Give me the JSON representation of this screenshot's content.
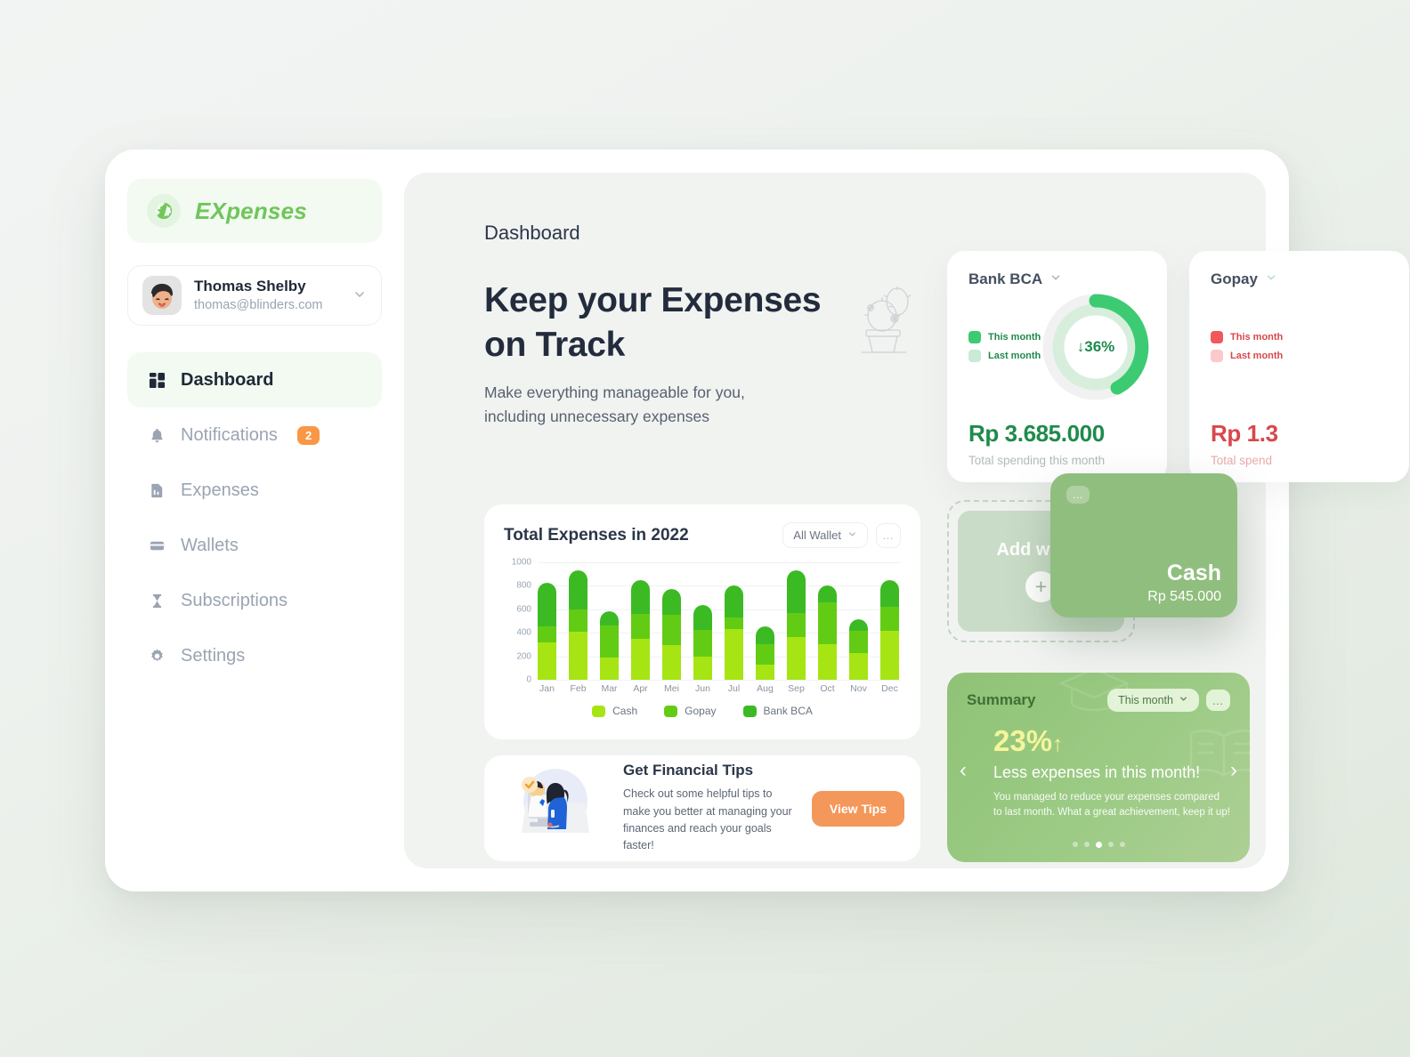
{
  "sidebar": {
    "brand": {
      "name": "EXpenses",
      "icon": "globe-icon"
    },
    "profile": {
      "name": "Thomas Shelby",
      "email": "thomas@blinders.com",
      "chevron": "chevron-down-icon"
    },
    "items": [
      {
        "label": "Dashboard",
        "icon": "grid-icon",
        "active": true,
        "badge": ""
      },
      {
        "label": "Notifications",
        "icon": "bell-icon",
        "active": false,
        "badge": "2"
      },
      {
        "label": "Expenses",
        "icon": "document-icon",
        "active": false,
        "badge": ""
      },
      {
        "label": "Wallets",
        "icon": "card-icon",
        "active": false,
        "badge": ""
      },
      {
        "label": "Subscriptions",
        "icon": "hourglass-icon",
        "active": false,
        "badge": ""
      },
      {
        "label": "Settings",
        "icon": "gear-icon",
        "active": false,
        "badge": ""
      }
    ]
  },
  "main": {
    "breadcrumb": "Dashboard",
    "hero_line1": "Keep your Expenses",
    "hero_line2": "on Track",
    "hero_sub1": "Make everything manageable for you,",
    "hero_sub2": "including unnecessary expenses",
    "hero_illustration": "cactus-icon"
  },
  "chart_card": {
    "title": "Total Expenses in 2022",
    "wallet_filter": "All Wallet",
    "filter_chevron": "chevron-down-icon",
    "more": "…"
  },
  "chart_data": {
    "type": "bar",
    "title": "Total Expenses in 2022",
    "xlabel": "",
    "ylabel": "",
    "ylim": [
      0,
      1000
    ],
    "yticks": [
      0,
      200,
      400,
      600,
      800,
      1000
    ],
    "grid": true,
    "stacked": true,
    "legend_position": "bottom",
    "categories": [
      "Jan",
      "Feb",
      "Mar",
      "Apr",
      "Mei",
      "Jun",
      "Jul",
      "Aug",
      "Sep",
      "Oct",
      "Nov",
      "Dec"
    ],
    "series": [
      {
        "name": "Cash",
        "color": "#a6e513",
        "values": [
          320,
          410,
          190,
          345,
          295,
          200,
          430,
          130,
          360,
          305,
          225,
          420
        ]
      },
      {
        "name": "Gopay",
        "color": "#62cc14",
        "values": [
          135,
          190,
          275,
          215,
          255,
          225,
          100,
          170,
          205,
          355,
          195,
          205
        ]
      },
      {
        "name": "Bank BCA",
        "color": "#3cba24",
        "values": [
          370,
          330,
          115,
          290,
          225,
          215,
          275,
          155,
          370,
          145,
          95,
          220
        ]
      }
    ],
    "totals": [
      825,
      930,
      580,
      850,
      775,
      640,
      805,
      455,
      935,
      805,
      515,
      845
    ]
  },
  "tips_card": {
    "title": "Get Financial Tips",
    "body": "Check out some helpful tips to make you better at managing your finances and reach your goals faster!",
    "button": "View Tips",
    "illustration": "people-at-computer-icon"
  },
  "wallet_stats": [
    {
      "name": "Bank BCA",
      "chevron": "chevron-down-icon",
      "legend": [
        {
          "label": "This month",
          "color": "#3ccb72"
        },
        {
          "label": "Last month",
          "color": "#c9ead4"
        }
      ],
      "donut_label": "↓36%",
      "donut_percent": 36,
      "amount": "Rp 3.685.000",
      "subtitle": "Total spending this month",
      "theme": "green"
    },
    {
      "name": "Gopay",
      "chevron": "chevron-down-icon",
      "legend": [
        {
          "label": "This month",
          "color": "#f2575b"
        },
        {
          "label": "Last month",
          "color": "#fbc9cb"
        }
      ],
      "donut_label": "",
      "donut_percent": 0,
      "amount": "Rp 1.3",
      "subtitle": "Total spend",
      "theme": "red"
    }
  ],
  "add_wallet": {
    "label": "Add wallet",
    "plus": "+"
  },
  "cash_card": {
    "more": "…",
    "name": "Cash",
    "amount": "Rp 545.000"
  },
  "summary": {
    "title": "Summary",
    "period": "This month",
    "period_chevron": "chevron-down-icon",
    "more": "…",
    "percent": "23%",
    "trend_arrow": "↑",
    "headline": "Less expenses in this month!",
    "description": "You managed to reduce your expenses compared to last month. What a great achievement, keep it up!",
    "prev": "‹",
    "next": "›",
    "dots_total": 5,
    "dots_active_index": 2
  }
}
